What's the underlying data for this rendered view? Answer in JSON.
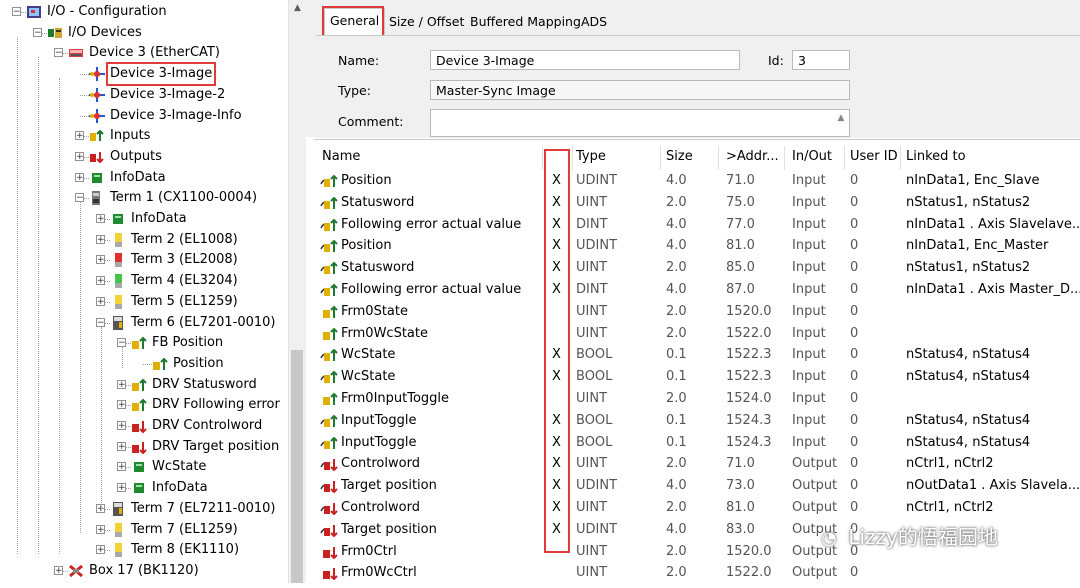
{
  "tree": {
    "items": [
      {
        "label": "I/O - Configuration",
        "depth": 0,
        "expander": "-",
        "icon": "io-config-icon",
        "highlight": false
      },
      {
        "label": "I/O Devices",
        "depth": 1,
        "expander": "-",
        "icon": "io-devices-icon",
        "highlight": false
      },
      {
        "label": "Device 3 (EtherCAT)",
        "depth": 2,
        "expander": "-",
        "icon": "ethercat-device-icon",
        "highlight": false
      },
      {
        "label": "Device 3-Image",
        "depth": 3,
        "expander": "",
        "icon": "image-icon",
        "highlight": true
      },
      {
        "label": "Device 3-Image-2",
        "depth": 3,
        "expander": "",
        "icon": "image-icon",
        "highlight": false
      },
      {
        "label": "Device 3-Image-Info",
        "depth": 3,
        "expander": "",
        "icon": "image-icon",
        "highlight": false
      },
      {
        "label": "Inputs",
        "depth": 3,
        "expander": "+",
        "icon": "inputs-icon",
        "highlight": false
      },
      {
        "label": "Outputs",
        "depth": 3,
        "expander": "+",
        "icon": "outputs-icon",
        "highlight": false
      },
      {
        "label": "InfoData",
        "depth": 3,
        "expander": "+",
        "icon": "infodata-icon",
        "highlight": false
      },
      {
        "label": "Term 1 (CX1100-0004)",
        "depth": 3,
        "expander": "-",
        "icon": "terminal-icon",
        "highlight": false
      },
      {
        "label": "InfoData",
        "depth": 4,
        "expander": "+",
        "icon": "infodata-icon",
        "highlight": false
      },
      {
        "label": "Term 2 (EL1008)",
        "depth": 4,
        "expander": "+",
        "icon": "terminal-yellow-icon",
        "highlight": false
      },
      {
        "label": "Term 3 (EL2008)",
        "depth": 4,
        "expander": "+",
        "icon": "terminal-red-icon",
        "highlight": false
      },
      {
        "label": "Term 4 (EL3204)",
        "depth": 4,
        "expander": "+",
        "icon": "terminal-green-icon",
        "highlight": false
      },
      {
        "label": "Term 5 (EL1259)",
        "depth": 4,
        "expander": "+",
        "icon": "terminal-yellow-icon",
        "highlight": false
      },
      {
        "label": "Term 6 (EL7201-0010)",
        "depth": 4,
        "expander": "-",
        "icon": "terminal-drive-icon",
        "highlight": false
      },
      {
        "label": "FB Position",
        "depth": 5,
        "expander": "-",
        "icon": "input-var-icon",
        "highlight": false
      },
      {
        "label": "Position",
        "depth": 6,
        "expander": "",
        "icon": "input-var-icon",
        "highlight": false
      },
      {
        "label": "DRV Statusword",
        "depth": 5,
        "expander": "+",
        "icon": "input-var-icon",
        "highlight": false
      },
      {
        "label": "DRV Following error",
        "depth": 5,
        "expander": "+",
        "icon": "input-var-icon",
        "highlight": false
      },
      {
        "label": "DRV Controlword",
        "depth": 5,
        "expander": "+",
        "icon": "output-var-icon",
        "highlight": false
      },
      {
        "label": "DRV Target position",
        "depth": 5,
        "expander": "+",
        "icon": "output-var-icon",
        "highlight": false
      },
      {
        "label": "WcState",
        "depth": 5,
        "expander": "+",
        "icon": "infodata-icon",
        "highlight": false
      },
      {
        "label": "InfoData",
        "depth": 5,
        "expander": "+",
        "icon": "infodata-icon",
        "highlight": false
      },
      {
        "label": "Term 7 (EL7211-0010)",
        "depth": 4,
        "expander": "+",
        "icon": "terminal-drive-icon",
        "highlight": false
      },
      {
        "label": "Term 7 (EL1259)",
        "depth": 4,
        "expander": "+",
        "icon": "terminal-yellow-icon",
        "highlight": false
      },
      {
        "label": "Term 8 (EK1110)",
        "depth": 4,
        "expander": "+",
        "icon": "terminal-yellow-icon",
        "highlight": false
      },
      {
        "label": "Box 17 (BK1120)",
        "depth": 2,
        "expander": "+",
        "icon": "box-icon",
        "highlight": false
      }
    ]
  },
  "props": {
    "tabs": [
      "General",
      "Size / Offset",
      "Buffered Mapping",
      "ADS"
    ],
    "active_tab": "General",
    "name_label": "Name:",
    "name_value": "Device 3-Image",
    "id_label": "Id:",
    "id_value": "3",
    "type_label": "Type:",
    "type_value": "Master-Sync Image",
    "comment_label": "Comment:",
    "comment_value": ""
  },
  "grid": {
    "columns": [
      "Name",
      "",
      "Type",
      "Size",
      ">Addr...",
      "In/Out",
      "User ID",
      "Linked to"
    ],
    "rows": [
      {
        "name": "Position",
        "x": "X",
        "type": "UDINT",
        "size": "4.0",
        "addr": "71.0",
        "io": "Input",
        "uid": "0",
        "linked": "nInData1, Enc_Slave",
        "icon": "input-linked-icon"
      },
      {
        "name": "Statusword",
        "x": "X",
        "type": "UINT",
        "size": "2.0",
        "addr": "75.0",
        "io": "Input",
        "uid": "0",
        "linked": "nStatus1, nStatus2",
        "icon": "input-linked-icon"
      },
      {
        "name": "Following error actual value",
        "x": "X",
        "type": "DINT",
        "size": "4.0",
        "addr": "77.0",
        "io": "Input",
        "uid": "0",
        "linked": "nInData1 . Axis Slavelave...",
        "icon": "input-linked-icon"
      },
      {
        "name": "Position",
        "x": "X",
        "type": "UDINT",
        "size": "4.0",
        "addr": "81.0",
        "io": "Input",
        "uid": "0",
        "linked": "nInData1, Enc_Master",
        "icon": "input-linked-icon"
      },
      {
        "name": "Statusword",
        "x": "X",
        "type": "UINT",
        "size": "2.0",
        "addr": "85.0",
        "io": "Input",
        "uid": "0",
        "linked": "nStatus1, nStatus2",
        "icon": "input-linked-icon"
      },
      {
        "name": "Following error actual value",
        "x": "X",
        "type": "DINT",
        "size": "4.0",
        "addr": "87.0",
        "io": "Input",
        "uid": "0",
        "linked": "nInData1 . Axis Master_D...",
        "icon": "input-linked-icon"
      },
      {
        "name": "Frm0State",
        "x": "",
        "type": "UINT",
        "size": "2.0",
        "addr": "1520.0",
        "io": "Input",
        "uid": "0",
        "linked": "",
        "icon": "input-icon"
      },
      {
        "name": "Frm0WcState",
        "x": "",
        "type": "UINT",
        "size": "2.0",
        "addr": "1522.0",
        "io": "Input",
        "uid": "0",
        "linked": "",
        "icon": "input-icon"
      },
      {
        "name": "WcState",
        "x": "X",
        "type": "BOOL",
        "size": "0.1",
        "addr": "1522.3",
        "io": "Input",
        "uid": "0",
        "linked": "nStatus4, nStatus4",
        "icon": "input-linked-icon"
      },
      {
        "name": "WcState",
        "x": "X",
        "type": "BOOL",
        "size": "0.1",
        "addr": "1522.3",
        "io": "Input",
        "uid": "0",
        "linked": "nStatus4, nStatus4",
        "icon": "input-linked-icon"
      },
      {
        "name": "Frm0InputToggle",
        "x": "",
        "type": "UINT",
        "size": "2.0",
        "addr": "1524.0",
        "io": "Input",
        "uid": "0",
        "linked": "",
        "icon": "input-icon"
      },
      {
        "name": "InputToggle",
        "x": "X",
        "type": "BOOL",
        "size": "0.1",
        "addr": "1524.3",
        "io": "Input",
        "uid": "0",
        "linked": "nStatus4, nStatus4",
        "icon": "input-linked-icon"
      },
      {
        "name": "InputToggle",
        "x": "X",
        "type": "BOOL",
        "size": "0.1",
        "addr": "1524.3",
        "io": "Input",
        "uid": "0",
        "linked": "nStatus4, nStatus4",
        "icon": "input-linked-icon"
      },
      {
        "name": "Controlword",
        "x": "X",
        "type": "UINT",
        "size": "2.0",
        "addr": "71.0",
        "io": "Output",
        "uid": "0",
        "linked": "nCtrl1, nCtrl2",
        "icon": "output-linked-icon"
      },
      {
        "name": "Target position",
        "x": "X",
        "type": "UDINT",
        "size": "4.0",
        "addr": "73.0",
        "io": "Output",
        "uid": "0",
        "linked": "nOutData1 . Axis Slavela...",
        "icon": "output-linked-icon"
      },
      {
        "name": "Controlword",
        "x": "X",
        "type": "UINT",
        "size": "2.0",
        "addr": "81.0",
        "io": "Output",
        "uid": "0",
        "linked": "nCtrl1, nCtrl2",
        "icon": "output-linked-icon"
      },
      {
        "name": "Target position",
        "x": "X",
        "type": "UDINT",
        "size": "4.0",
        "addr": "83.0",
        "io": "Output",
        "uid": "0",
        "linked": "",
        "icon": "output-linked-icon"
      },
      {
        "name": "Frm0Ctrl",
        "x": "",
        "type": "UINT",
        "size": "2.0",
        "addr": "1520.0",
        "io": "Output",
        "uid": "0",
        "linked": "",
        "icon": "output-icon"
      },
      {
        "name": "Frm0WcCtrl",
        "x": "",
        "type": "UINT",
        "size": "2.0",
        "addr": "1522.0",
        "io": "Output",
        "uid": "0",
        "linked": "",
        "icon": "output-icon"
      }
    ]
  },
  "watermark": "Lizzy的悟福园地",
  "colors": {
    "highlight": "#e03a3a",
    "selection_border": "#e03a3a",
    "panel_bg": "#f0f0f0"
  }
}
